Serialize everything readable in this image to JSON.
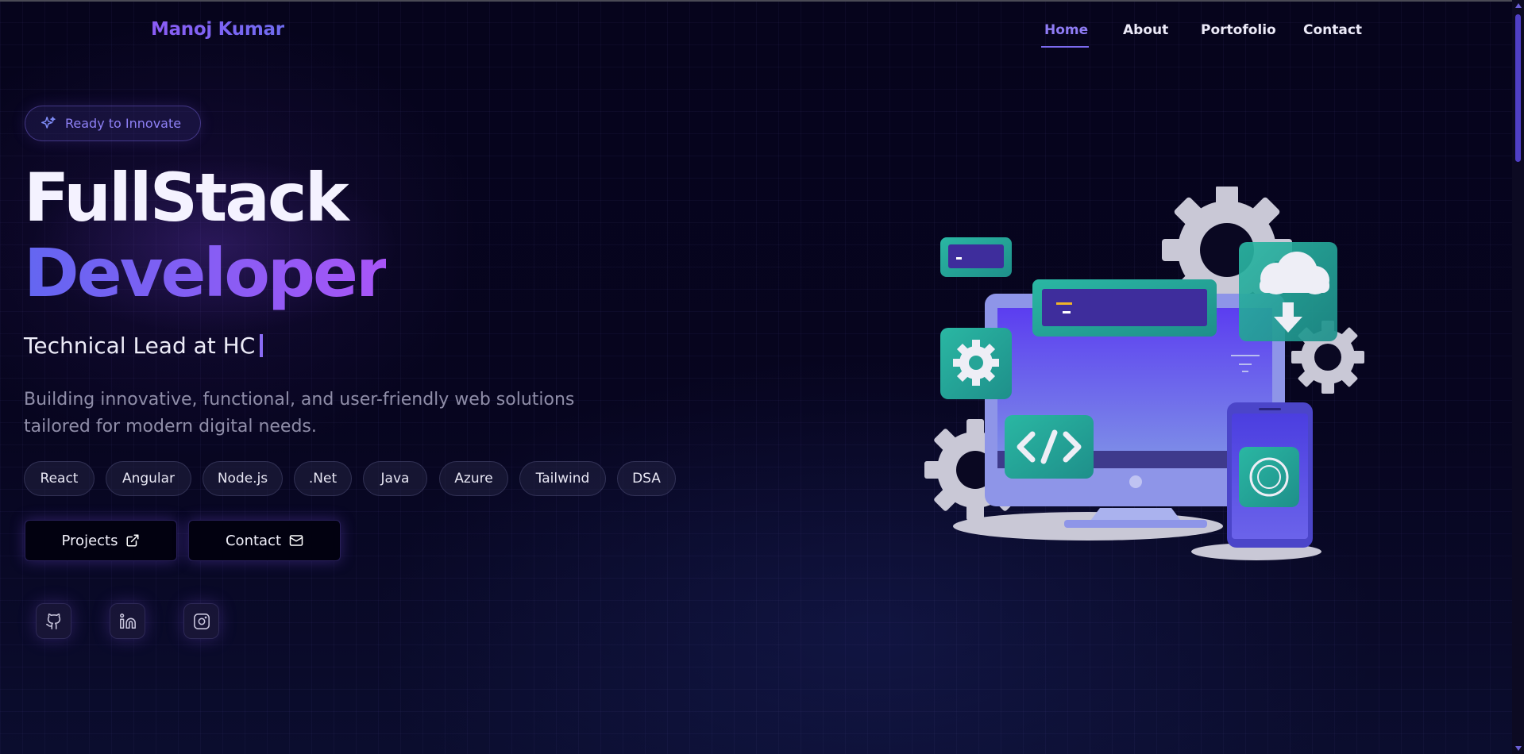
{
  "nav": {
    "brand": "Manoj Kumar",
    "items": [
      {
        "label": "Home",
        "active": true
      },
      {
        "label": "About",
        "active": false
      },
      {
        "label": "Portofolio",
        "active": false
      },
      {
        "label": "Contact",
        "active": false
      }
    ]
  },
  "hero": {
    "badge": "Ready to Innovate",
    "title_line1": "FullStack",
    "title_line2": "Developer",
    "subtitle": "Technical Lead at HC",
    "description": "Building innovative, functional, and user-friendly web solutions tailored for modern digital needs.",
    "tags": [
      "React",
      "Angular",
      "Node.js",
      ".Net",
      "Java",
      "Azure",
      "Tailwind",
      "DSA"
    ],
    "buttons": {
      "projects": "Projects",
      "contact": "Contact"
    },
    "socials": [
      {
        "name": "github",
        "icon": "github-icon"
      },
      {
        "name": "linkedin",
        "icon": "linkedin-icon"
      },
      {
        "name": "instagram",
        "icon": "instagram-icon"
      }
    ]
  },
  "colors": {
    "accent": "#8b5cf6",
    "accent_blue": "#6366f1",
    "background": "#05031a",
    "teal": "#2bb5a0"
  }
}
